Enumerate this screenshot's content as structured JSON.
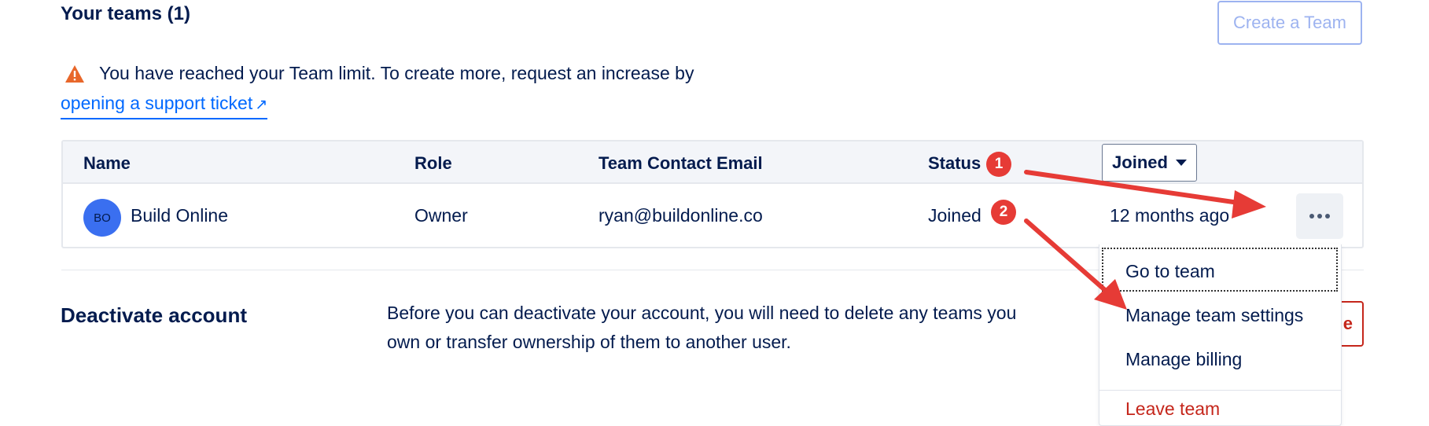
{
  "teams": {
    "title": "Your teams (1)",
    "create_button": "Create a Team",
    "warning_text": "You have reached your Team limit. To create more, request an increase by",
    "support_link": "opening a support ticket",
    "support_link_icon": "external-link-icon",
    "columns": {
      "name": "Name",
      "role": "Role",
      "email": "Team Contact Email",
      "status": "Status",
      "sort": "Joined"
    },
    "rows": [
      {
        "initials": "BO",
        "name": "Build Online",
        "role": "Owner",
        "email": "ryan@buildonline.co",
        "status": "Joined",
        "joined": "12 months ago"
      }
    ]
  },
  "menu": {
    "items": [
      {
        "label": "Go to team"
      },
      {
        "label": "Manage team settings"
      },
      {
        "label": "Manage billing"
      },
      {
        "label": "Leave team"
      }
    ]
  },
  "deactivate": {
    "title": "Deactivate account",
    "description": "Before you can deactivate your account, you will need to delete any teams you own or transfer ownership of them to another user.",
    "button_visible_text": "e"
  },
  "annotations": {
    "badges": [
      "1",
      "2"
    ],
    "color": "#e63b36"
  },
  "colors": {
    "text": "#031b4e",
    "link": "#0069ff",
    "danger": "#c5261b",
    "warning": "#e8672a",
    "avatar": "#3a6ff0"
  }
}
